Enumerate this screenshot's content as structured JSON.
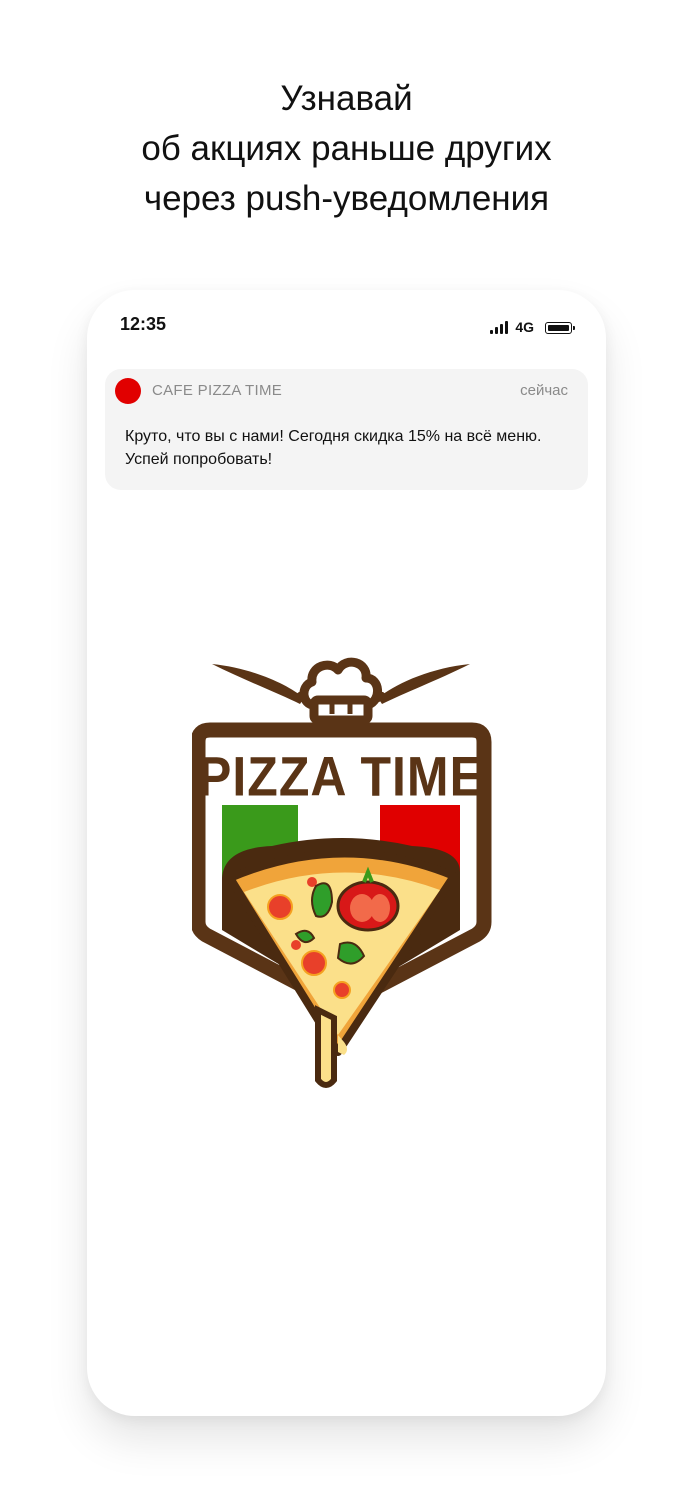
{
  "headline": {
    "line1": "Узнавай",
    "line2": "об акциях раньше других",
    "line3": "через push-уведомления"
  },
  "status_bar": {
    "time": "12:35",
    "network": "4G",
    "icons": [
      "signal-bars-icon",
      "battery-icon"
    ]
  },
  "notification": {
    "app_name": "CAFE PIZZA TIME",
    "time": "сейчас",
    "message": "Круто, что вы с нами! Сегодня скидка 15% на всё меню. Успей попробовать!",
    "icon_color": "#e10000"
  },
  "logo": {
    "text": "PIZZA TIME",
    "colors": {
      "brown": "#5a3416",
      "green": "#3a9a1b",
      "red": "#e00000",
      "crust": "#f0a43a",
      "cheese": "#fbe08a"
    }
  }
}
